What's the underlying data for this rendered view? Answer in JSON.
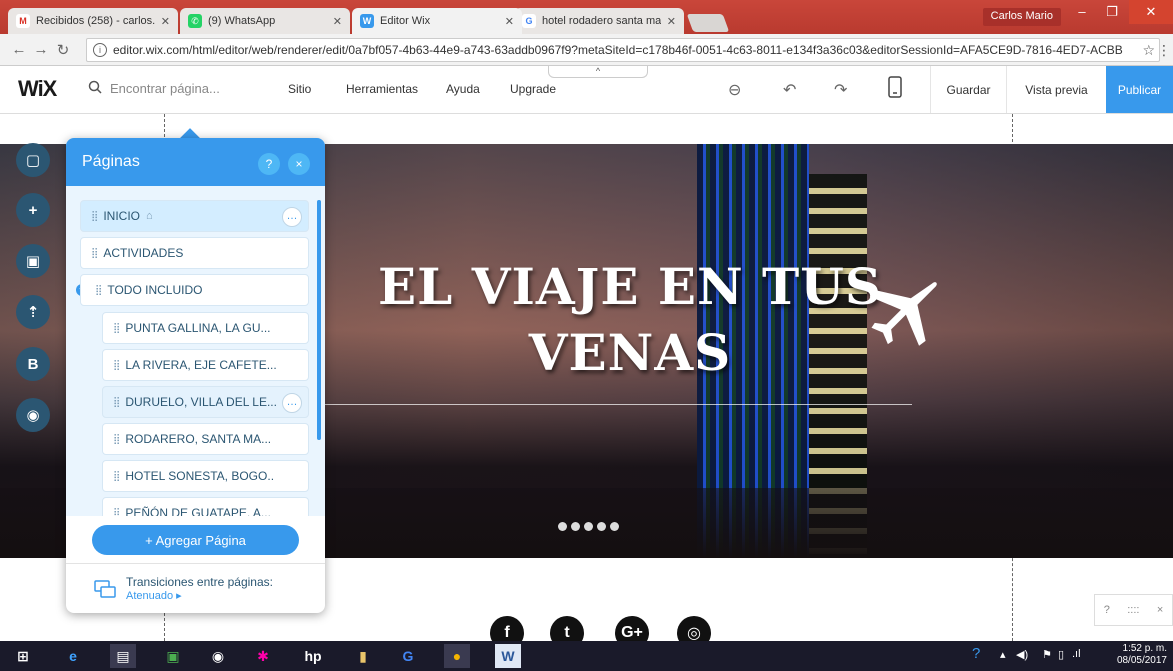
{
  "browser": {
    "tabs": [
      {
        "title": "Recibidos (258) - carlos.",
        "icon": "gmail-icon",
        "color": "#d93025"
      },
      {
        "title": "(9) WhatsApp",
        "icon": "whatsapp-icon",
        "color": "#25d366"
      },
      {
        "title": "Editor Wix",
        "icon": "wix-icon",
        "color": "#3899ec"
      },
      {
        "title": "hotel rodadero santa ma",
        "icon": "google-icon",
        "color": "#4285f4"
      }
    ],
    "profile": "Carlos Mario",
    "url": "editor.wix.com/html/editor/web/renderer/edit/0a7bf057-4b63-44e9-a743-63addb0967f9?metaSiteId=c178b46f-0051-4c63-8011-e134f3a36c03&editorSessionId=AFA5CE9D-7816-4ED7-ACBB"
  },
  "wix_topbar": {
    "logo": "WiX",
    "search_placeholder": "Encontrar página...",
    "menu": [
      "Sitio",
      "Herramientas",
      "Ayuda",
      "Upgrade"
    ],
    "save": "Guardar",
    "preview": "Vista previa",
    "publish": "Publicar"
  },
  "hero": {
    "title_line1": "EL VIAJE EN TUS",
    "title_line2": "VENAS"
  },
  "pages_panel": {
    "title": "Páginas",
    "help": "?",
    "close": "×",
    "pages": [
      {
        "label": "INICIO",
        "home": true
      },
      {
        "label": "ACTIVIDADES"
      },
      {
        "label": "TODO INCLUIDO"
      },
      {
        "label": "PUNTA GALLINA, LA GU..."
      },
      {
        "label": "LA RIVERA, EJE CAFETE..."
      },
      {
        "label": "DURUELO, VILLA DEL LE..."
      },
      {
        "label": "RODARERO, SANTA MA..."
      },
      {
        "label": "HOTEL SONESTA, BOGO.."
      },
      {
        "label": "PEÑÓN DE GUATAPE, A..."
      }
    ],
    "add_page": "+ Agregar Página",
    "transitions_label": "Transiciones entre páginas:",
    "transitions_value": "Atenuado ▸"
  },
  "mini_help": {
    "q": "?",
    "grip": "::::",
    "close": "×"
  },
  "taskbar": {
    "time": "1:52 p. m.",
    "date": "08/05/2017"
  }
}
